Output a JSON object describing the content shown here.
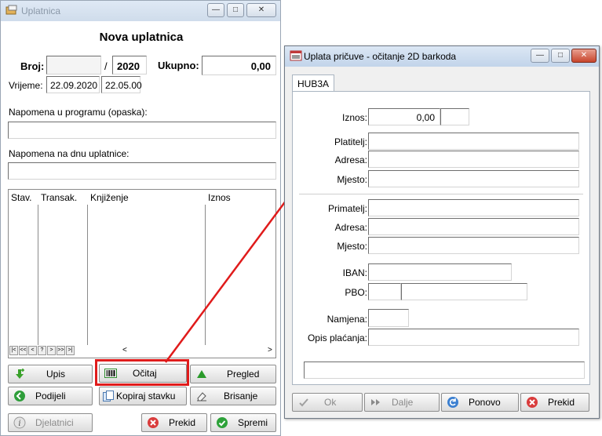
{
  "colors": {
    "accent_red": "#e01b1b",
    "titlebar_blue": "#c2d4ea"
  },
  "main_window": {
    "title": "Uplatnica",
    "heading": "Nova uplatnica",
    "broj_label": "Broj:",
    "broj_value": "",
    "slash": "/",
    "year": "2020",
    "ukupno_label": "Ukupno:",
    "ukupno_value": "0,00",
    "vrijeme_label": "Vrijeme:",
    "date": "22.09.2020",
    "time": "22.05.00",
    "napomena_program_label": "Napomena u programu (opaska):",
    "napomena_program_value": "",
    "napomena_dno_label": "Napomena na dnu uplatnice:",
    "napomena_dno_value": "",
    "grid_columns": [
      "Stav.",
      "Transak.",
      "Knjiženje",
      "Iznos"
    ],
    "nav_buttons": [
      "|<",
      "<<",
      "<",
      "?",
      ">",
      ">>",
      ">|"
    ],
    "scroll_left": "<",
    "scroll_right": ">",
    "buttons": {
      "upis": "Upis",
      "ocitaj": "Očitaj",
      "pregled": "Pregled",
      "podijeli": "Podijeli",
      "kopiraj": "Kopiraj stavku",
      "brisanje": "Brisanje",
      "djelatnici": "Djelatnici",
      "prekid": "Prekid",
      "spremi": "Spremi"
    },
    "window_controls": {
      "minimize": "—",
      "maximize": "□",
      "close": "✕"
    }
  },
  "barcode_window": {
    "title": "Uplata pričuve - očitanje 2D barkoda",
    "tab": "HUB3A",
    "iznos_label": "Iznos:",
    "iznos_value": "0,00",
    "iznos_currency": "",
    "platitelj_label": "Platitelj:",
    "platitelj_value": "",
    "adresa1_label": "Adresa:",
    "adresa1_value": "",
    "mjesto1_label": "Mjesto:",
    "mjesto1_value": "",
    "primatelj_label": "Primatelj:",
    "primatelj_value": "",
    "adresa2_label": "Adresa:",
    "adresa2_value": "",
    "mjesto2_label": "Mjesto:",
    "mjesto2_value": "",
    "iban_label": "IBAN:",
    "iban_value": "",
    "pbo_label": "PBO:",
    "pbo_model": "",
    "pbo_value": "",
    "namjena_label": "Namjena:",
    "namjena_value": "",
    "opis_label": "Opis plaćanja:",
    "opis_value": "",
    "scan_value": "",
    "buttons": {
      "ok": "Ok",
      "dalje": "Dalje",
      "ponovo": "Ponovo",
      "prekid": "Prekid"
    },
    "window_controls": {
      "minimize": "—",
      "maximize": "□",
      "close": "✕"
    }
  }
}
